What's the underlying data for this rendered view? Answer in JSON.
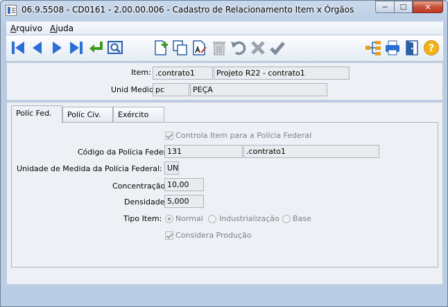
{
  "window": {
    "title": "06.9.5508 - CD0161 - 2.00.00.006 - Cadastro de Relacionamento Item x Órgãos",
    "min_glyph": "─",
    "max_glyph": "☐",
    "close_glyph": "✕"
  },
  "menu": [
    {
      "label": "Arquivo"
    },
    {
      "label": "Ajuda"
    }
  ],
  "toolbar": {
    "icons": [
      "first-icon",
      "previous-icon",
      "next-icon",
      "last-icon",
      "goto-icon",
      "search-icon",
      "new-icon",
      "copy-icon",
      "edit-icon",
      "delete-icon",
      "undo-icon",
      "cancel-icon",
      "confirm-icon",
      "tree-icon",
      "print-icon",
      "exit-icon",
      "help-icon"
    ]
  },
  "header": {
    "item_label": "Item:",
    "item_code": ".contrato1",
    "item_desc": "Projeto R22 - contrato1",
    "unid_label": "Unid Medid:",
    "unid_code": "pc",
    "unid_desc": "PEÇA"
  },
  "tabs": [
    {
      "label": "Políc Fed."
    },
    {
      "label": "Políc Civ."
    },
    {
      "label": "Exército"
    }
  ],
  "form": {
    "controla_label": "Controla Item para a Polícia Federal",
    "codigo_label": "Código da Polícia Federal:",
    "codigo_value": "131",
    "codigo_desc": ".contrato1",
    "unidade_label": "Unidade de Medida da Polícia Federal:",
    "unidade_value": "UN",
    "concentracao_label": "Concentração:",
    "concentracao_value": "10,00",
    "densidade_label": "Densidade:",
    "densidade_value": "5,000",
    "tipo_label": "Tipo Item:",
    "tipo_options": [
      "Normal",
      "Industrialização",
      "Base"
    ],
    "considera_label": "Considera Produção"
  }
}
